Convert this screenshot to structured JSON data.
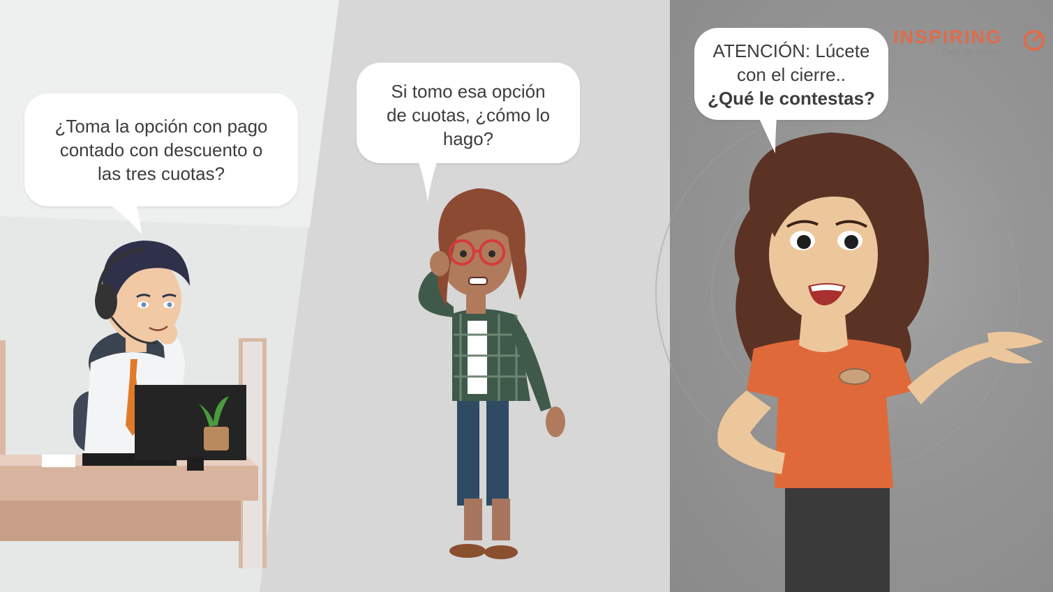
{
  "scene": {
    "colors": {
      "panel_left": "#e6e8e8",
      "panel_middle": "#d7d7d7",
      "panel_right": "#959595",
      "logo_accent": "#e06b4a",
      "bubble_text": "#3d3d3d"
    }
  },
  "bubbles": {
    "left": {
      "lines": [
        "¿Toma la opción con pago",
        "contado con descuento o",
        "las tres cuotas?"
      ]
    },
    "middle": {
      "lines": [
        "Si tomo esa opción",
        "de cuotas, ¿cómo lo",
        "hago?"
      ]
    },
    "right": {
      "lines": [
        "ATENCIÓN: Lúcete",
        "con el cierre..",
        "¿Qué le contestas?"
      ]
    }
  },
  "logo": {
    "word": "INSPIRING",
    "tagline": "Time for Action",
    "icon": "target-circle-icon"
  },
  "characters": [
    {
      "name": "call-center-agent",
      "icon": "headset-agent-illustration"
    },
    {
      "name": "confused-customer",
      "icon": "customer-illustration"
    },
    {
      "name": "presenter",
      "icon": "presenter-illustration"
    }
  ]
}
